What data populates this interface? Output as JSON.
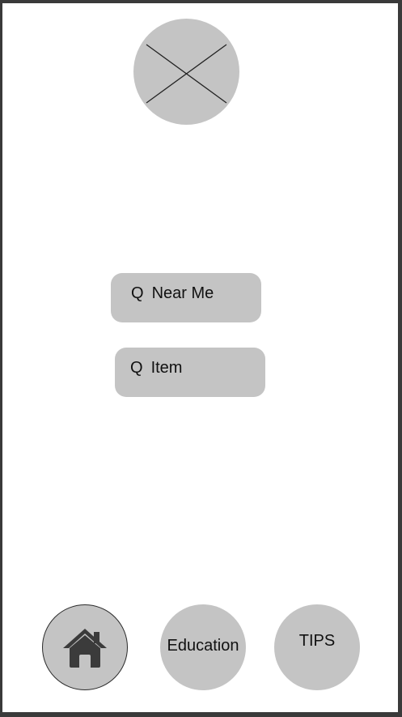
{
  "logo": {
    "icon": "image-placeholder-icon"
  },
  "search": {
    "near_me": {
      "icon_glyph": "Q",
      "label": "Near Me"
    },
    "item": {
      "icon_glyph": "Q",
      "label": "Item"
    }
  },
  "bottom_nav": {
    "home": {
      "icon": "home-icon"
    },
    "education": {
      "label": "Education"
    },
    "tips": {
      "label": "TIPS"
    }
  },
  "colors": {
    "placeholder_gray": "#c4c4c4",
    "frame_border": "#3a3a3a",
    "text": "#111111"
  }
}
